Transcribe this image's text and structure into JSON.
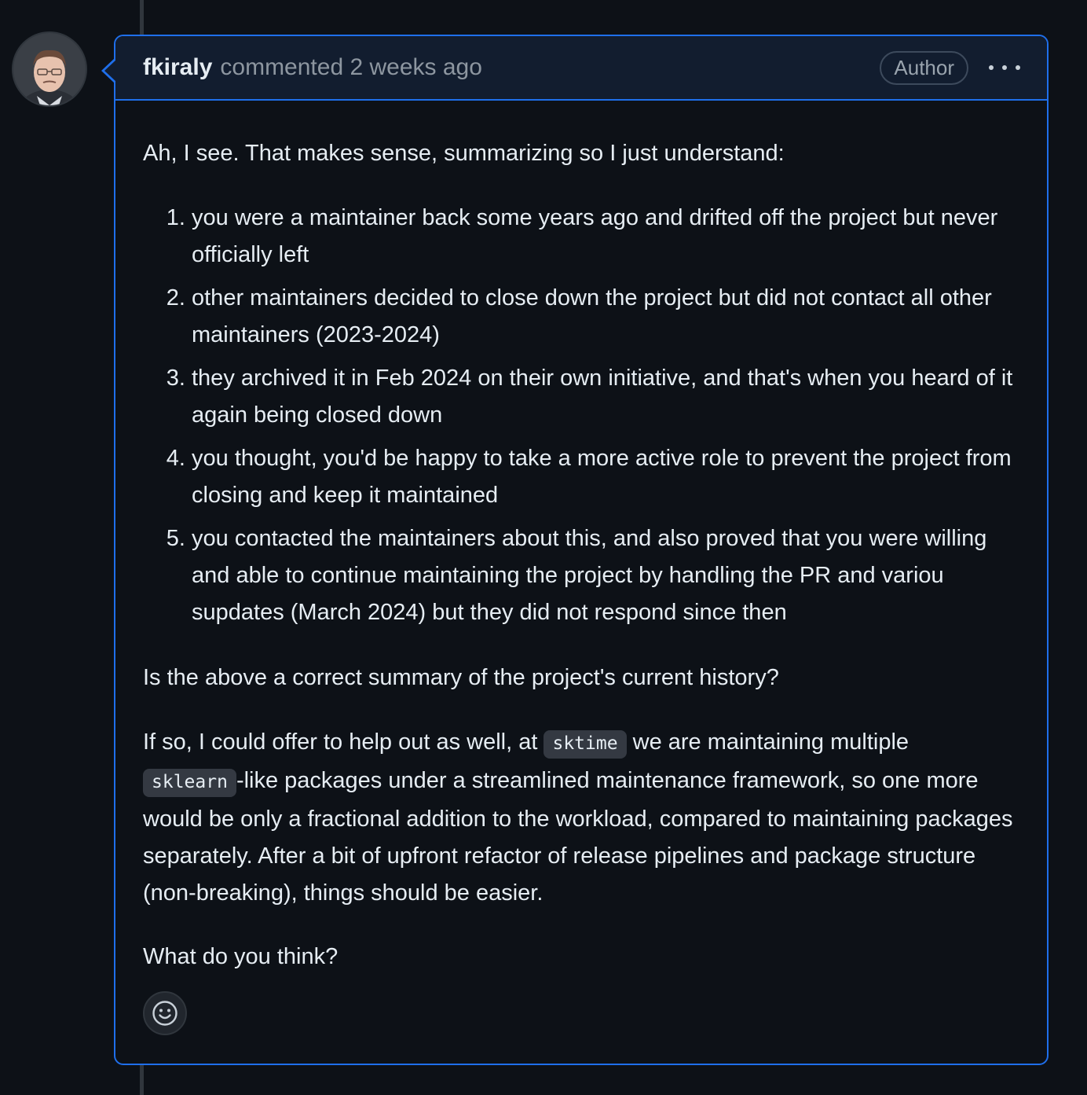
{
  "comment": {
    "author": "fkiraly",
    "meta": "commented 2 weeks ago",
    "badge": "Author",
    "menu_icon": "kebab-horizontal-icon",
    "intro": "Ah, I see. That makes sense, summarizing so I just understand:",
    "list": [
      "you were a maintainer back some years ago and drifted off the project but never officially left",
      "other maintainers decided to close down the project but did not contact all other maintainers (2023-2024)",
      "they archived it in Feb 2024 on their own initiative, and that's when you heard of it again being closed down",
      "you thought, you'd be happy to take a more active role to prevent the project from closing and keep it maintained",
      "you contacted the maintainers about this, and also proved that you were willing and able to continue maintaining the project by handling the PR and variou supdates (March 2024) but they did not respond since then"
    ],
    "question": "Is the above a correct summary of the project's current history?",
    "offer": {
      "part1": "If so, I could offer to help out as well, at ",
      "code1": "sktime",
      "part2": " we are maintaining multiple ",
      "code2": "sklearn",
      "part3": "-like packages under a streamlined maintenance framework, so one more would be only a fractional addition to the workload, compared to maintaining packages separately. After a bit of upfront refactor of release pipelines and package structure (non-breaking), things should be easier."
    },
    "closing": "What do you think?",
    "reaction_icon": "smiley-icon"
  },
  "colors": {
    "background": "#0d1117",
    "header_bg": "#121d2f",
    "border_accent": "#1f6feb",
    "muted_text": "#8d96a0"
  }
}
